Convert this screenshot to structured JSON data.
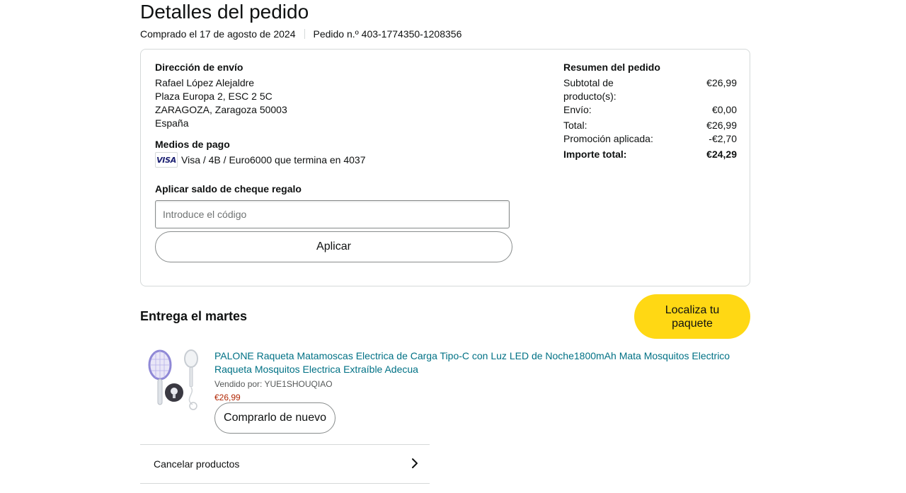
{
  "header": {
    "title": "Detalles del pedido",
    "purchased_on": "Comprado el 17 de agosto de 2024",
    "order_number": "Pedido n.º 403-1774350-1208356"
  },
  "shipping": {
    "heading": "Dirección de envío",
    "lines": [
      "Rafael López Alejaldre",
      "Plaza Europa 2, ESC 2 5C",
      "ZARAGOZA, Zaragoza 50003",
      "España"
    ]
  },
  "payment": {
    "heading": "Medios de pago",
    "card_icon": "visa-icon",
    "card_brand": "VISA",
    "card_text": "Visa / 4B / Euro6000  que termina en 4037"
  },
  "gift_card": {
    "heading": "Aplicar saldo de cheque regalo",
    "input_placeholder": "Introduce el código",
    "input_value": "",
    "apply_label": "Aplicar"
  },
  "summary": {
    "heading": "Resumen del pedido",
    "rows": [
      {
        "label": "Subtotal de producto(s):",
        "value": "€26,99"
      },
      {
        "label": "Envío:",
        "value": "€0,00"
      },
      {
        "label": "Total:",
        "value": "€26,99"
      },
      {
        "label": "Promoción aplicada:",
        "value": "-€2,70"
      },
      {
        "label": "Importe total:",
        "value": "€24,29"
      }
    ]
  },
  "delivery": {
    "title": "Entrega el martes",
    "track_label": "Localiza tu paquete"
  },
  "product": {
    "title": "PALONE Raqueta Matamoscas Electrica de Carga Tipo-C con Luz LED de Noche1800mAh Mata Mosquitos Electrico Raqueta Mosquitos Electrica Extraíble Adecua",
    "sold_by": "Vendido por: YUE1SHOUQIAO",
    "price": "€26,99",
    "rebuy_label": "Comprarlo de nuevo",
    "image_icon": "fly-swatter-racket-image"
  },
  "actions": {
    "cancel_label": "Cancelar productos",
    "cancel_icon": "chevron-right-icon"
  },
  "colors": {
    "link": "#007185",
    "price": "#b12704",
    "track_button": "#ffd814",
    "border": "#d5d9d9"
  }
}
